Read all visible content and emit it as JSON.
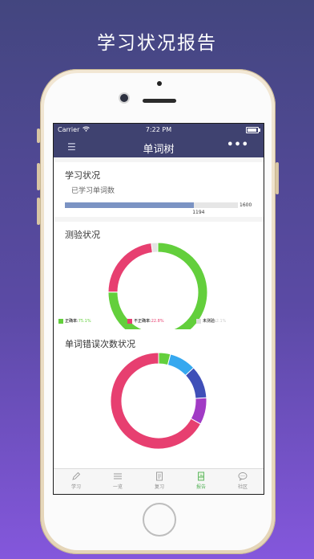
{
  "headline": "学习状况报告",
  "status_bar": {
    "carrier": "Carrier",
    "time": "7:22 PM"
  },
  "nav": {
    "title": "单词树",
    "more": "•••"
  },
  "learning": {
    "title": "学习状况",
    "subtitle": "已学习单词数",
    "learned": 1194,
    "total": 1600,
    "learned_label": "1194",
    "total_label": "1600",
    "bar_color": "#7b93c3"
  },
  "quiz": {
    "title": "测验状况",
    "legend": [
      {
        "label": "正确率:",
        "value": "75.1%",
        "color": "#63cf3c"
      },
      {
        "label": "不正确率:",
        "value": "22.8%",
        "color": "#e73f70"
      },
      {
        "label": "未测验:",
        "value": "2.1%",
        "color": "#dddddd"
      }
    ],
    "chart_data": {
      "type": "pie",
      "categories": [
        "正确率",
        "不正确率",
        "未测验"
      ],
      "values": [
        75.1,
        22.8,
        2.1
      ],
      "colors": [
        "#63cf3c",
        "#e73f70",
        "#e4e4e4"
      ]
    }
  },
  "errors": {
    "title": "单词错误次数状况",
    "chart_data": {
      "type": "pie",
      "values": [
        4,
        9,
        11,
        9,
        67
      ],
      "colors": [
        "#63cf3c",
        "#36a8ef",
        "#3f4fb8",
        "#a13bc5",
        "#e73f70"
      ]
    }
  },
  "tabs": [
    {
      "label": "学习",
      "icon": "pencil-icon",
      "active": false
    },
    {
      "label": "一览",
      "icon": "list-icon",
      "active": false
    },
    {
      "label": "复习",
      "icon": "document-icon",
      "active": false
    },
    {
      "label": "报告",
      "icon": "report-icon",
      "active": true
    },
    {
      "label": "社区",
      "icon": "chat-bubble-icon",
      "active": false
    }
  ],
  "accent_colors": {
    "nav": "#3f4270",
    "active_tab": "#57b35a"
  }
}
